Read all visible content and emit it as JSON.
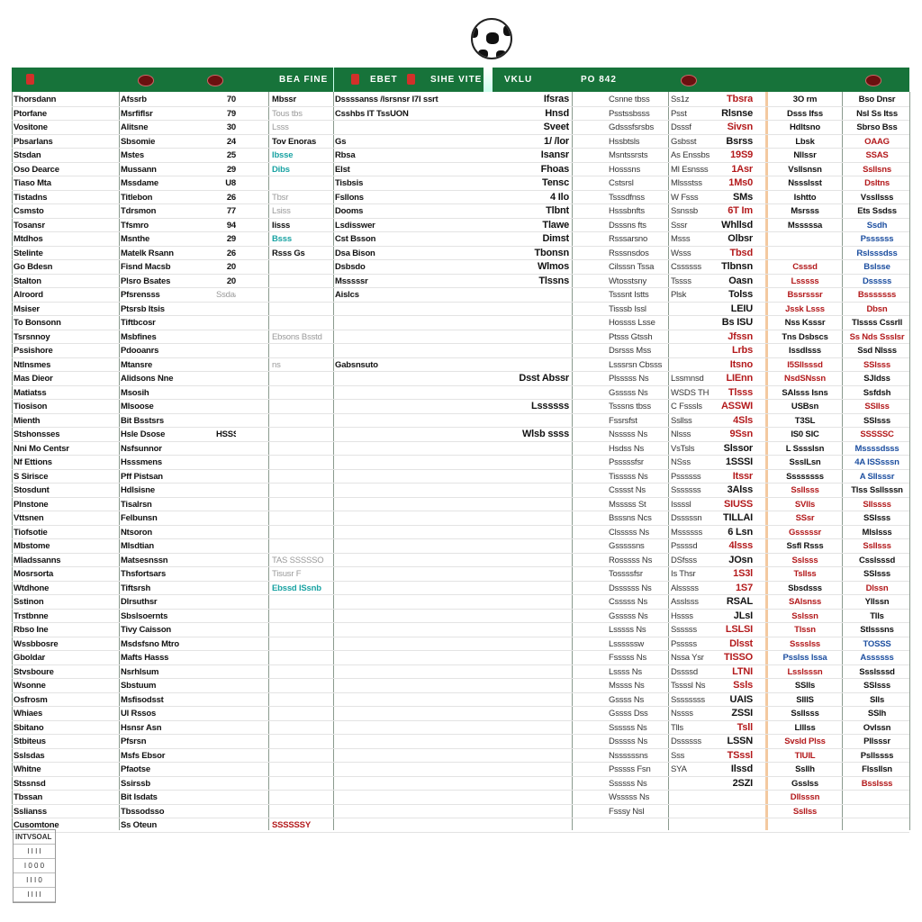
{
  "header": {
    "labels": [
      "BEA FINE",
      "EBET",
      "SIHE VITE",
      "VKLU",
      "PO 842"
    ],
    "accent": "#17733a"
  },
  "colors": {
    "red": "#b3191b",
    "green": "#1a7a3c",
    "teal": "#1aa3a3",
    "blue": "#1d4fa0"
  },
  "rows": [
    [
      "Thorsdann",
      "Afssrb",
      "70",
      "Mbssr",
      "Dssssanss /lsrsnsr  I7I  ssrt",
      "Ifsras",
      "Csnne tbss",
      "Ss1z",
      "Tbsra",
      "3O rm",
      "Bso Dnsr"
    ],
    [
      "Ptorfane",
      "Msrfiflsr",
      "79",
      "Tous tbs",
      "Csshbs  IT TssUON",
      "Hnsd",
      "Psstssbsss",
      "Psst",
      "Rlsnse",
      "Dsss Ifss",
      "Nsl Ss Itss"
    ],
    [
      "Vositone",
      "Alitsne",
      "30",
      "Lsss",
      "",
      "Sveet",
      "Gdsssfsrsbs",
      "Dsssf",
      "Sivsn",
      "Hdltsno",
      "Sbrso Bss"
    ],
    [
      "Pbsarlans",
      "Sbsomie",
      "24",
      "Tov Enoras",
      "Gs",
      "1/ /lor",
      "Hssbtsls",
      "Gsbsst",
      "Bsrss",
      "Lbsk",
      "OAAG"
    ],
    [
      "Stsdan",
      "Mstes",
      "25",
      "Ibsse",
      "Rbsa",
      "Isansr",
      "Msntssrsts",
      "As Enssbs",
      "19S9",
      "Nllssr",
      "SSAS"
    ],
    [
      "Oso Dearce",
      "Mussann",
      "29",
      "Dibs",
      "Elst",
      "Fhoas",
      "Hosssns",
      "Ml Esnsss",
      "1Asr",
      "Vsllsnsn",
      "Ssllsns"
    ],
    [
      "Tiaso Mta",
      "Mssdame",
      "U8",
      "",
      "Tisbsis",
      "Tensc",
      "Cstsrsl",
      "Mlssstss",
      "1Ms0",
      "Nssslsst",
      "Dsltns"
    ],
    [
      "Tistadns",
      "Titlebon",
      "26",
      "Tbsr",
      "Fsllons",
      "4 Ilo",
      "Tsssdfnss",
      "W Fsss",
      "SMs",
      "Ishtto",
      "Vssllsss"
    ],
    [
      "Csmsto",
      "Tdrsmon",
      "77",
      "Lsiss",
      "Dooms",
      "Tlbnt",
      "Hsssbnfts",
      "Ssnssb",
      "6T Im",
      "Msrsss",
      "Ets Ssdss"
    ],
    [
      "Tosansr",
      "Tfsmro",
      "94",
      "Iisss",
      "Lsdisswer",
      "Tlawe",
      "Dsssns fts",
      "Sssr",
      "Whllsd",
      "Msssssa",
      "Ssdh"
    ],
    [
      "Mtdhos",
      "Msnthe",
      "29",
      "Bsss",
      "Cst Bsson",
      "Dimst",
      "Rsssarsno",
      "Msss",
      "Olbsr",
      "",
      "Pssssss"
    ],
    [
      "Stelinte",
      "Matelk Rsann",
      "26",
      "Rsss Gs",
      "Dsa Bison",
      "Tbonsn",
      "Rsssnsdos",
      "Wsss",
      "Tbsd",
      "",
      "Rslsssdss"
    ],
    [
      "Go Bdesn",
      "Fisnd Macsb",
      "20",
      "",
      "Dsbsdo",
      "Wlmos",
      "Cilsssn Tssa",
      "Cssssss",
      "Tlbnsn",
      "Csssd",
      "Bslsse"
    ],
    [
      "Stalton",
      "Plsro Bsates",
      "20",
      "",
      "Msssssr",
      "Tlssns",
      "Wtosstsny",
      "Tssss",
      "Oasn",
      "Lsssss",
      "Dsssss"
    ],
    [
      "Alroord",
      "Pfsrensss",
      "Ssdaa",
      "",
      "Aislcs",
      "",
      "Tsssnt Istts",
      "Plsk",
      "Tolss",
      "Bssrsssr",
      "Bsssssss"
    ],
    [
      "Msiser",
      "Ptsrsb Itsis",
      "",
      "",
      "",
      "",
      "Tisssb Issl",
      "",
      "LEIU",
      "Jssk Lsss",
      "Dbsn"
    ],
    [
      "To Bonsonn",
      "Tiftbcosr",
      "",
      "",
      "",
      "",
      "Hossss Lsse",
      "",
      "Bs ISU",
      "Nss Ksssr",
      "Tlssss Cssrll"
    ],
    [
      "Tsrsnnoy",
      "Msbfines",
      "",
      "Ebsons Bsstd",
      "",
      "",
      "Ptsss Gtssh",
      "",
      "Jfssn",
      "Tns Dsbscs",
      "Ss Nds Ssslsr"
    ],
    [
      "Pssishore",
      "Pdooanrs",
      "",
      "",
      "",
      "",
      "Dsrsss Mss",
      "",
      "Lrbs",
      "Issdlsss",
      "Ssd Nlsss"
    ],
    [
      "Ntlnsmes",
      "Mtansre",
      "",
      "ns",
      "Gabsnsuto",
      "",
      "Lsssrsn Cbsss",
      "",
      "Itsno",
      "I5Sllsssd",
      "SSlsss"
    ],
    [
      "Mas Dieor",
      "Alidsons Nne",
      "",
      "",
      "",
      "Dsst Abssr",
      "Plsssss Ns",
      "Lssmnsd",
      "LIEnn",
      "NsdSNssn",
      "SJldss"
    ],
    [
      "Matiatss",
      "Msosih",
      "",
      "",
      "",
      "",
      "Gsssss Ns",
      "WSDS TH",
      "Tlsss",
      "SAlsss Isns",
      "Ssfdsh"
    ],
    [
      "Tiosison",
      "Mlsoose",
      "",
      "",
      "",
      "Lssssss",
      "Tsssns tbss",
      "C Fsssls",
      "ASSWI",
      "USBsn",
      "SSllss"
    ],
    [
      "Mienth",
      "Bit Bsstsrs",
      "",
      "",
      "",
      "",
      "Fssrsfst",
      "Ssllss",
      "4Sls",
      "T3SL",
      "SSlsss"
    ],
    [
      "Stshonsses",
      "Hsle Dsose",
      "HSSS SSSSH ?",
      "",
      "",
      "Wlsb ssss",
      "Nsssss Ns",
      "Nlsss",
      "9Ssn",
      "IS0 SIC",
      "SSSSSC"
    ],
    [
      "Nni Mo Centsr",
      "Nsfsunnor",
      "",
      "",
      "",
      "",
      "Hsdss Ns",
      "VsTsls",
      "Slssor",
      "L Sssslsn",
      "Mssssdsss"
    ],
    [
      "Nf Ettions",
      "Hsssmens",
      "",
      "",
      "",
      "",
      "Psssssfsr",
      "NSss",
      "1SSSI",
      "SsslLsn",
      "4A ISSsssn"
    ],
    [
      "S Sirisce",
      "Pff Pistsan",
      "",
      "",
      "",
      "",
      "Tisssss Ns",
      "Pssssss",
      "Itssr",
      "Ssssssss",
      "A Sllsssr"
    ],
    [
      "Stosdunt",
      "Hdlsisne",
      "",
      "",
      "",
      "",
      "Csssst Ns",
      "Sssssss",
      "3Alss",
      "Ssllsss",
      "Tlss Ssllsssn"
    ],
    [
      "Plnstone",
      "Tisalrsn",
      "",
      "",
      "",
      "",
      "Msssss St",
      "Issssl",
      "SIUSS",
      "SVlls",
      "Sllssss"
    ],
    [
      "Vttsnen",
      "Felbunsn",
      "",
      "",
      "",
      "",
      "Bsssns Ncs",
      "Dsssssn",
      "TILLAI",
      "SSsr",
      "SSlsss"
    ],
    [
      "Tiofsotie",
      "Ntsoron",
      "",
      "",
      "",
      "",
      "Clsssss Ns",
      "Mssssss",
      "6 Lsn",
      "Gsssssr",
      "Mlslsss"
    ],
    [
      "Mbstome",
      "Mlsdtian",
      "",
      "",
      "",
      "",
      "Gsssssns",
      "Pssssd",
      "4lsss",
      "Ssfl Rsss",
      "Ssllsss"
    ],
    [
      "Mladssanns",
      "Matsesnssn",
      "",
      "TAS SSSSSO",
      "",
      "",
      "Rosssss Ns",
      "DSfsss",
      "JOsn",
      "Sslsss",
      "Csslsssd"
    ],
    [
      "Mosrsorta",
      "Thsfortsars",
      "",
      "Tisusr F",
      "",
      "",
      "Tossssfsr",
      "Is Thsr",
      "1S3l",
      "Tsllss",
      "SSlsss"
    ],
    [
      "Wtdhone",
      "Tiftsrsh",
      "",
      "Ebssd ISsnb",
      "",
      "",
      "Dssssss Ns",
      "Alsssss",
      "1S7",
      "Sbsdsss",
      "Dlssn"
    ],
    [
      "Sstinon",
      "Dlrsuthsr",
      "",
      "",
      "",
      "",
      "Csssss Ns",
      "Asslsss",
      "RSAL",
      "SAlsnss",
      "Yllssn"
    ],
    [
      "Trstbnne",
      "Sbslsoernts",
      "",
      "",
      "",
      "",
      "Gsssss Ns",
      "Hssss",
      "JLsI",
      "Sslssn",
      "Tlls"
    ],
    [
      "Rbso Ine",
      "Tivy Caisson",
      "",
      "",
      "",
      "",
      "Lsssss Ns",
      "Ssssss",
      "LSLSI",
      "Tlssn",
      "Stlsssns"
    ],
    [
      "Wssbbosre",
      "Msdsfsno Mtro",
      "",
      "",
      "",
      "",
      "Lssssssw",
      "Psssss",
      "Dlsst",
      "Sssslss",
      "TOSSS"
    ],
    [
      "Gboldar",
      "Mafts Hasss",
      "",
      "",
      "",
      "",
      "Fsssss Ns",
      "Nssa Ysr",
      "TISSO",
      "Psslss lssa",
      "Assssss"
    ],
    [
      "Stvsboure",
      "Nsrhlsum",
      "",
      "",
      "",
      "",
      "Lssss Ns",
      "Dssssd",
      "LTNI",
      "Lsslsssn",
      "Ssslsssd"
    ],
    [
      "Wsonne",
      "Sbstuum",
      "",
      "",
      "",
      "",
      "Mssss Ns",
      "Tssssl Ns",
      "Ssls",
      "SSlls",
      "SSlsss"
    ],
    [
      "Osfrosm",
      "Msfisodsst",
      "",
      "",
      "",
      "",
      "Gssss Ns",
      "Ssssssss",
      "UAIS",
      "SlllS",
      "Slls"
    ],
    [
      "Whiaes",
      "Ul Rssos",
      "",
      "",
      "",
      "",
      "Gssss Dss",
      "Nssss",
      "ZSSI",
      "Ssllsss",
      "SSlh"
    ],
    [
      "Sbitano",
      "Hsnsr Asn",
      "",
      "",
      "",
      "",
      "Ssssss Ns",
      "Tlls",
      "Tsll",
      "Llllss",
      "Ovlssn"
    ],
    [
      "Stbiteus",
      "Pfsrsn",
      "",
      "",
      "",
      "",
      "Dsssss Ns",
      "Dssssss",
      "LSSN",
      "Svsld Plss",
      "Pllsssr"
    ],
    [
      "Sslsdas",
      "Msfs Ebsor",
      "",
      "",
      "",
      "",
      "Nssssssns",
      "Sss",
      "TSssl",
      "TIUIL",
      "Psllssss"
    ],
    [
      "Whitne",
      "Pfaotse",
      "",
      "",
      "",
      "",
      "Psssss Fsn",
      "SYA",
      "Ilssd",
      "Ssllh",
      "Flssllsn"
    ],
    [
      "Stssnsd",
      "Ssirssb",
      "",
      "",
      "",
      "",
      "Ssssss Ns",
      "",
      "2SZI",
      "Gsslss",
      "Bsslsss"
    ],
    [
      "Tbssan",
      "Bit Isdats",
      "",
      "",
      "",
      "",
      "Wsssss Ns",
      "",
      "",
      "Dllsssn",
      ""
    ],
    [
      "Sslianss",
      "Tbssodsso",
      "",
      "",
      "",
      "",
      "Fsssy Nsl",
      "",
      "",
      "Ssllss",
      ""
    ],
    [
      "Cusomtone",
      "Ss Oteun",
      "",
      "SSSSSSY",
      "",
      "",
      "",
      "",
      "",
      "",
      ""
    ]
  ],
  "row_colors": {
    "d": "k.._tt_.._t_t.....g................tg...............r",
    "g2": "rkrkrrrkrkkrkkkkkrrrrrrrrkkrkrkkrkrrkkrrrrrkkrkrkk",
    "h": "kkkkkkkkkkkrrrrrkkkrrkkkkkkkrrrrkrrkrrrrbrkkkkrrkkrr",
    "i": "kkkrrrrkkbbbbbrrkrkrkkrkrbbbkrkkrkkrkkkbbkkkkkkkkrr"
  },
  "mini_table": {
    "header": "INTVSOAL",
    "rows": [
      "I I I I",
      "I 0 0 0",
      "I I I 0",
      "I I I I"
    ]
  }
}
